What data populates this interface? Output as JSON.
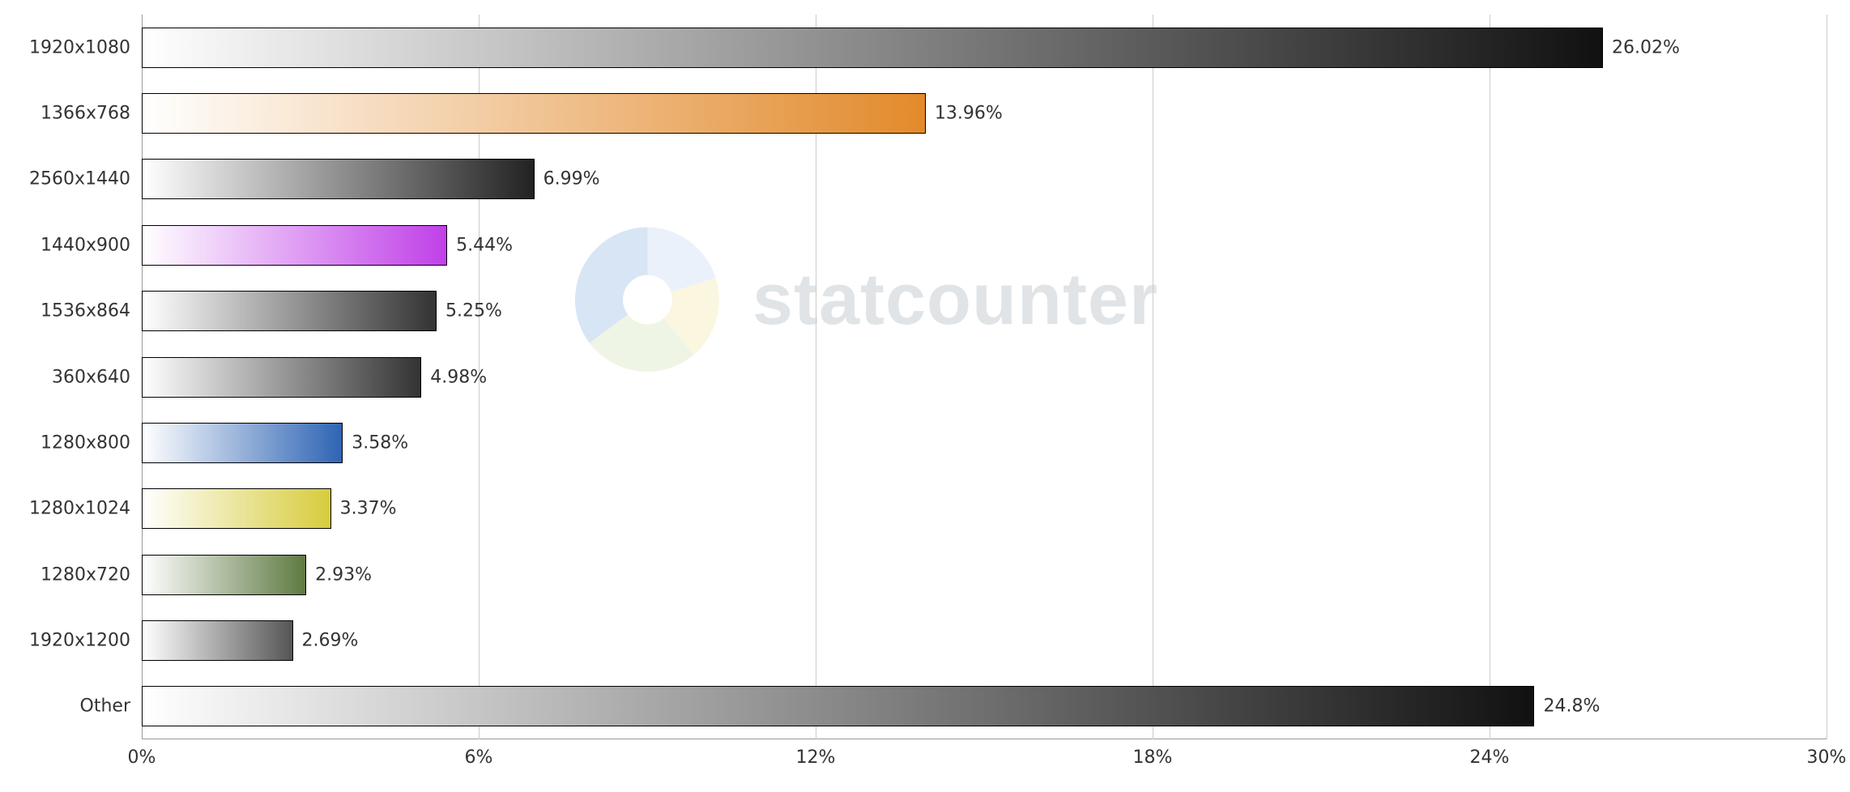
{
  "chart_data": {
    "type": "bar",
    "orientation": "horizontal",
    "xlabel": "",
    "ylabel": "",
    "xlim": [
      0,
      30
    ],
    "x_ticks": [
      0,
      6,
      12,
      18,
      24,
      30
    ],
    "x_tick_labels": [
      "0%",
      "6%",
      "12%",
      "18%",
      "24%",
      "30%"
    ],
    "categories": [
      "1920x1080",
      "1366x768",
      "2560x1440",
      "1440x900",
      "1536x864",
      "360x640",
      "1280x800",
      "1280x1024",
      "1280x720",
      "1920x1200",
      "Other"
    ],
    "values": [
      26.02,
      13.96,
      6.99,
      5.44,
      5.25,
      4.98,
      3.58,
      3.37,
      2.93,
      2.69,
      24.8
    ],
    "value_labels": [
      "26.02%",
      "13.96%",
      "6.99%",
      "5.44%",
      "5.25%",
      "4.98%",
      "3.58%",
      "3.37%",
      "2.93%",
      "2.69%",
      "24.8%"
    ],
    "colors": [
      "#111111",
      "#e28a2b",
      "#222222",
      "#c040e8",
      "#333333",
      "#333333",
      "#2e64b4",
      "#d7cc3d",
      "#5f7a42",
      "#555555",
      "#111111"
    ],
    "watermark": "statcounter"
  }
}
